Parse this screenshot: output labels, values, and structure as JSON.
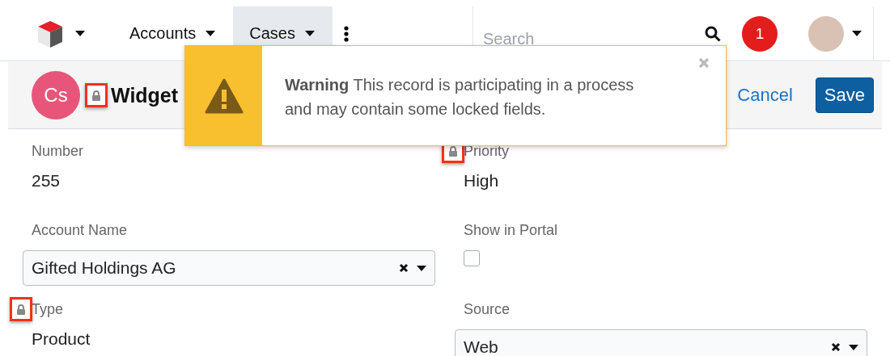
{
  "nav": {
    "tabs": [
      {
        "label": "Accounts",
        "selected": false
      },
      {
        "label": "Cases",
        "selected": true
      }
    ],
    "search": {
      "placeholder": "Search"
    },
    "notification_count": "1"
  },
  "header": {
    "avatar_initials": "Cs",
    "title": "Widget",
    "title_locked": true,
    "cancel": "Cancel",
    "save": "Save"
  },
  "alert": {
    "message": "**Warning** This record is participating in a process and may contain some locked fields."
  },
  "fields": [
    {
      "kind": "text",
      "label": "Number",
      "value": "255",
      "locked": false
    },
    {
      "kind": "text",
      "label": "Priority",
      "value": "High",
      "locked": true
    },
    {
      "kind": "select",
      "label": "Account Name",
      "value": "Gifted Holdings AG",
      "locked": false
    },
    {
      "kind": "checkbox",
      "label": "Show in Portal",
      "checked": false,
      "locked": false
    },
    {
      "kind": "text",
      "label": "Type",
      "value": "Product",
      "locked": true
    },
    {
      "kind": "select",
      "label": "Source",
      "value": "Web",
      "locked": false
    }
  ]
}
